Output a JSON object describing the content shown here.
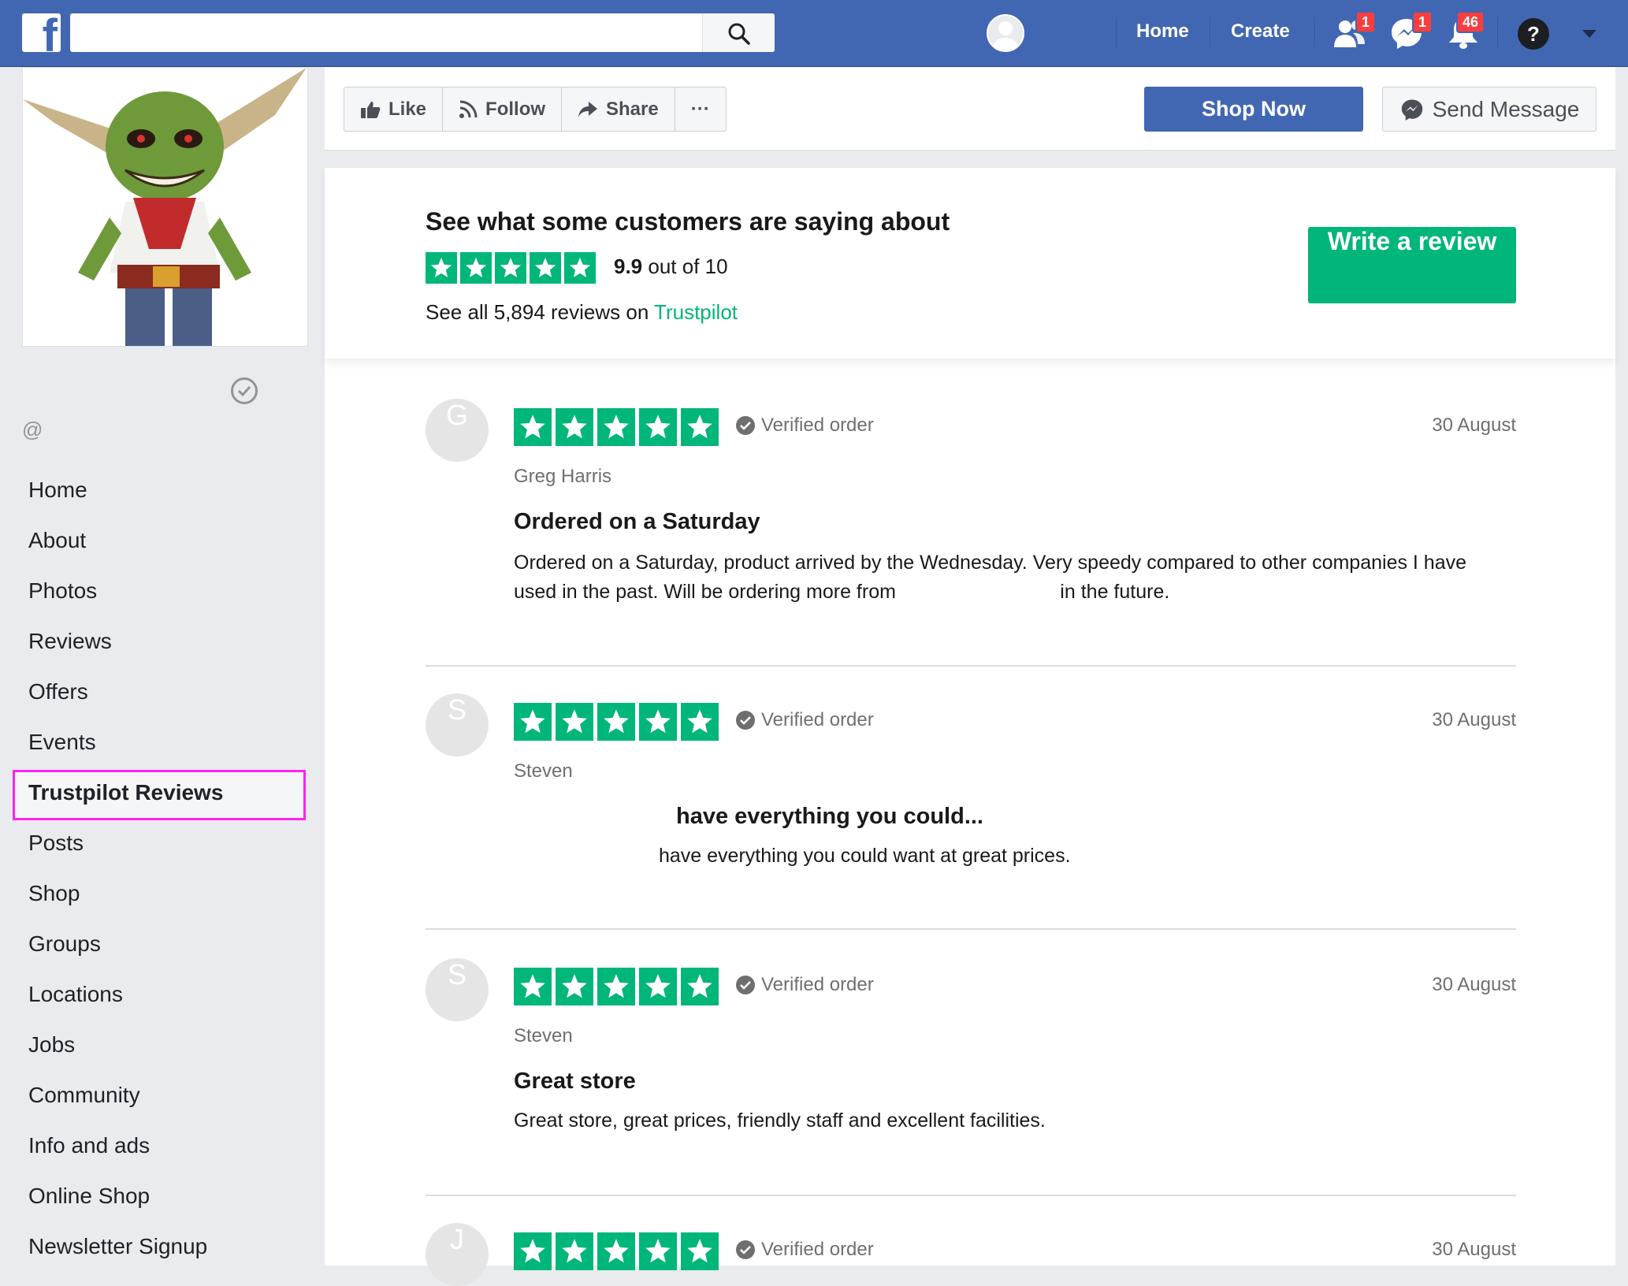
{
  "topbar": {
    "logo_letter": "f",
    "search_placeholder": "",
    "home_label": "Home",
    "create_label": "Create",
    "friend_requests_count": "1",
    "messages_count": "1",
    "notifications_count": "46",
    "help_symbol": "?"
  },
  "sidebar": {
    "handle": "@",
    "items": [
      {
        "label": "Home"
      },
      {
        "label": "About"
      },
      {
        "label": "Photos"
      },
      {
        "label": "Reviews"
      },
      {
        "label": "Offers"
      },
      {
        "label": "Events"
      },
      {
        "label": "Trustpilot Reviews",
        "active": true
      },
      {
        "label": "Posts"
      },
      {
        "label": "Shop"
      },
      {
        "label": "Groups"
      },
      {
        "label": "Locations"
      },
      {
        "label": "Jobs"
      },
      {
        "label": "Community"
      },
      {
        "label": "Info and ads"
      },
      {
        "label": "Online Shop"
      },
      {
        "label": "Newsletter Signup"
      }
    ]
  },
  "actions": {
    "like": "Like",
    "follow": "Follow",
    "share": "Share",
    "more": "···",
    "shop_now": "Shop Now",
    "send_message": "Send Message"
  },
  "trustpilot": {
    "title": "See what some customers are saying about",
    "score": "9.9",
    "score_suffix": " out of 10",
    "see_all_prefix": "See all 5,894 reviews on ",
    "brand": "Trustpilot",
    "write_review": "Write a review",
    "rating_stars": 5,
    "accent_color": "#00b67a"
  },
  "reviews": [
    {
      "initial": "G",
      "verified": "Verified order",
      "date": "30 August",
      "name": "Greg Harris",
      "title": "Ordered on a Saturday",
      "body_line1": "Ordered on a Saturday, product arrived by the Wednesday. Very speedy compared to other companies I have",
      "body_line2": "used in the past. Will be ordering more from                              in the future."
    },
    {
      "initial": "S",
      "verified": "Verified order",
      "date": "30 August",
      "name": "Steven",
      "title": "have everything you could...",
      "body_line1": "have everything you could want at great prices.",
      "body_line2": ""
    },
    {
      "initial": "S",
      "verified": "Verified order",
      "date": "30 August",
      "name": "Steven",
      "title": "Great store",
      "body_line1": "Great store, great prices, friendly staff and excellent facilities.",
      "body_line2": ""
    },
    {
      "initial": "J",
      "verified": "Verified order",
      "date": "30 August",
      "name": "",
      "title": "",
      "body_line1": "",
      "body_line2": ""
    }
  ]
}
